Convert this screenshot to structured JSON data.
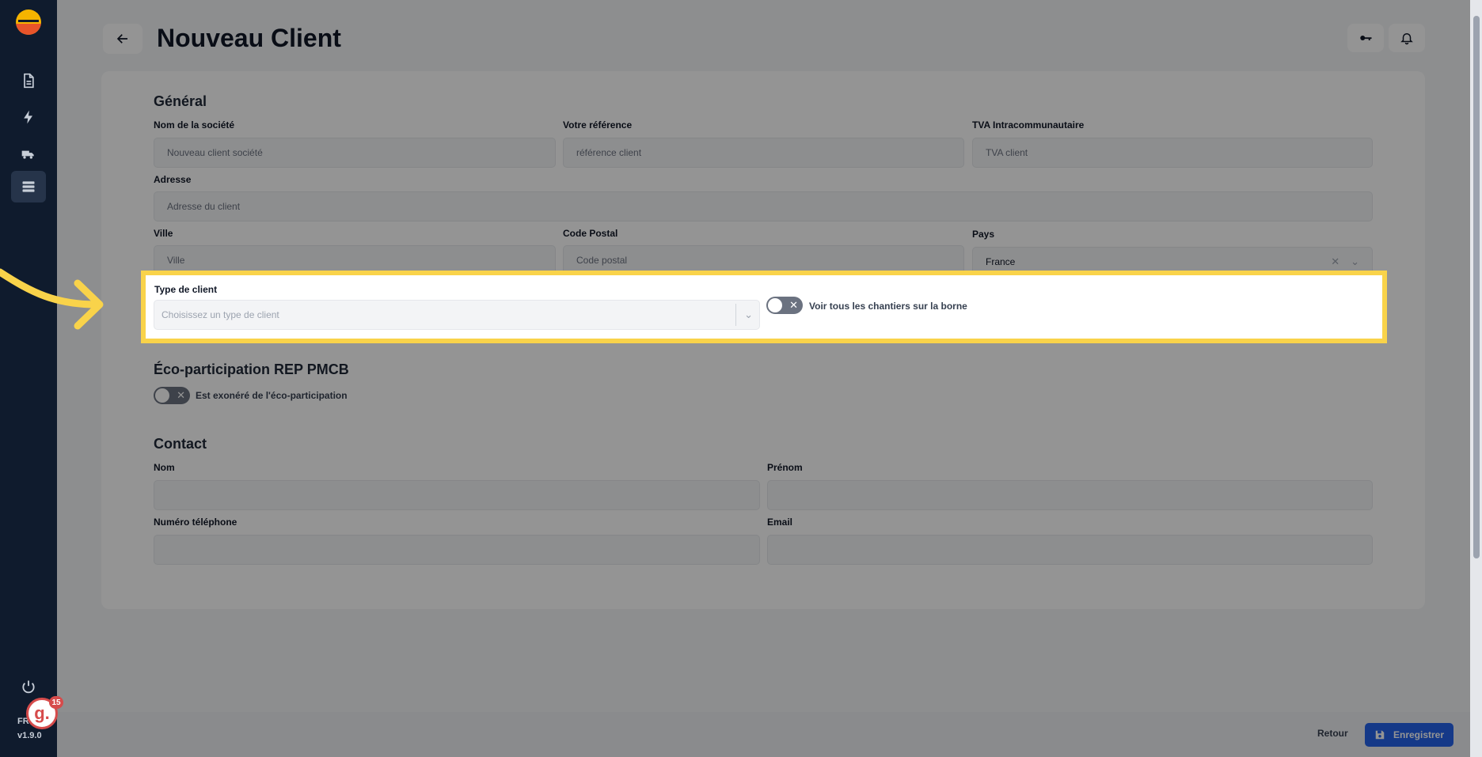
{
  "app": {
    "page_title": "Nouveau Client",
    "version_prefix": "FR",
    "version": "v1.9.0",
    "avatar_letter": "g.",
    "notification_count": "15"
  },
  "sections": {
    "general": "Général",
    "eco": "Éco-participation REP PMCB",
    "contact": "Contact"
  },
  "general": {
    "company_label": "Nom de la société",
    "company_placeholder": "Nouveau client société",
    "reference_label": "Votre référence",
    "reference_placeholder": "référence client",
    "vat_label": "TVA Intracommunautaire",
    "vat_placeholder": "TVA client",
    "address_label": "Adresse",
    "address_placeholder": "Adresse du client",
    "city_label": "Ville",
    "city_placeholder": "Ville",
    "zip_label": "Code Postal",
    "zip_placeholder": "Code postal",
    "country_label": "Pays",
    "country_value": "France"
  },
  "client_type": {
    "label": "Type de client",
    "placeholder": "Choisissez un type de client",
    "toggle_label": "Voir tous les chantiers sur la borne"
  },
  "eco": {
    "toggle_label": "Est exonéré de l'éco-participation"
  },
  "contact": {
    "lastname_label": "Nom",
    "firstname_label": "Prénom",
    "phone_label": "Numéro téléphone",
    "email_label": "Email"
  },
  "footer": {
    "back_label": "Retour",
    "save_label": "Enregistrer"
  },
  "colors": {
    "highlight": "#f9d34a",
    "primary": "#2563eb",
    "sidebar": "#0f1b2d"
  }
}
